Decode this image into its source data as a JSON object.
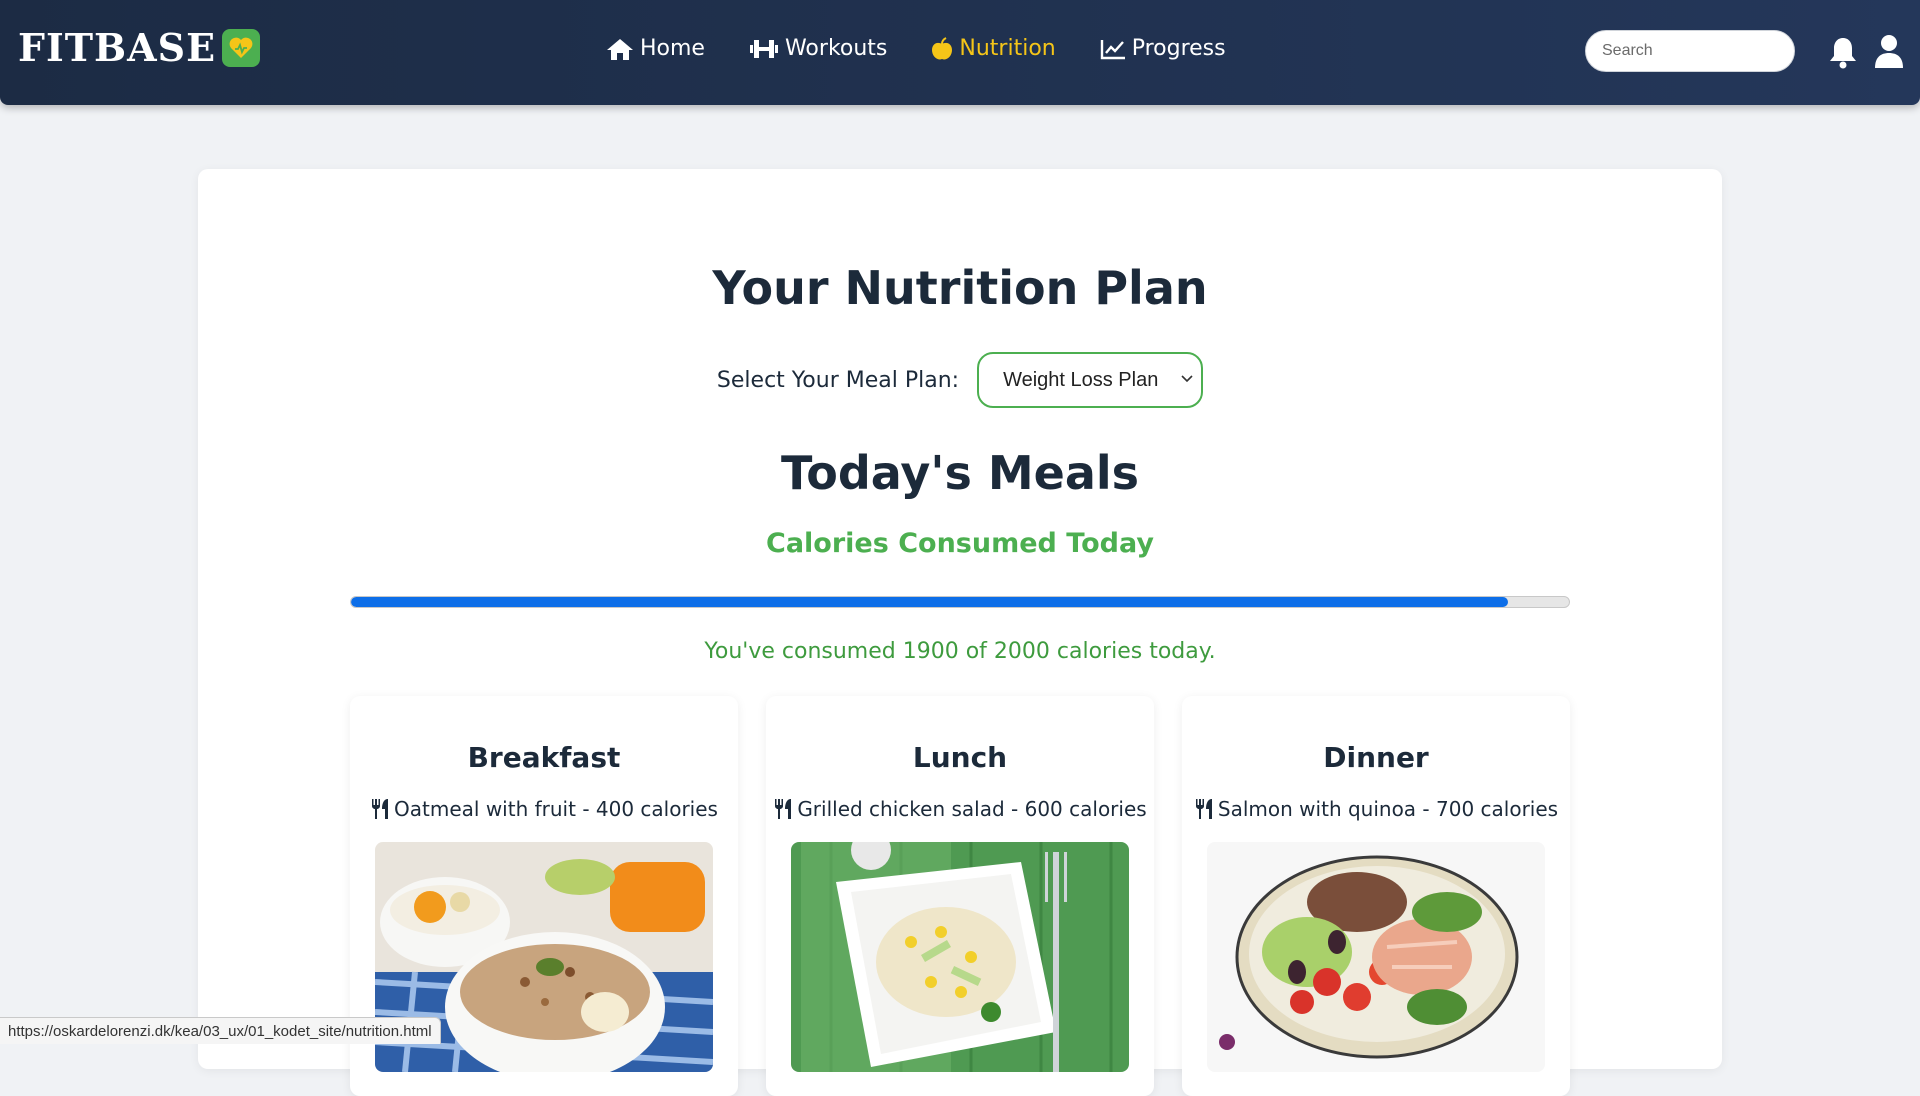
{
  "header": {
    "logo_text": "FITBASE",
    "nav": [
      {
        "label": "Home",
        "icon": "home-icon",
        "active": false
      },
      {
        "label": "Workouts",
        "icon": "dumbbell-icon",
        "active": false
      },
      {
        "label": "Nutrition",
        "icon": "apple-icon",
        "active": true
      },
      {
        "label": "Progress",
        "icon": "chart-line-icon",
        "active": false
      }
    ],
    "search_placeholder": "Search",
    "active_color": "#f5c518"
  },
  "main": {
    "title": "Your Nutrition Plan",
    "plan_label": "Select Your Meal Plan:",
    "plan_selected": "Weight Loss Plan",
    "meals_title": "Today's Meals",
    "calories_title": "Calories Consumed Today",
    "calories_consumed": 1900,
    "calories_goal": 2000,
    "calories_text": "You've consumed 1900 of 2000 calories today."
  },
  "meals": [
    {
      "name": "Breakfast",
      "description": "Oatmeal with fruit - 400 calories"
    },
    {
      "name": "Lunch",
      "description": "Grilled chicken salad - 600 calories"
    },
    {
      "name": "Dinner",
      "description": "Salmon with quinoa - 700 calories"
    }
  ],
  "status_url": "https://oskardelorenzi.dk/kea/03_ux/01_kodet_site/nutrition.html",
  "colors": {
    "accent_green": "#4caf50",
    "progress_blue": "#0d6ee8",
    "header_bg": "#1c2b44"
  }
}
